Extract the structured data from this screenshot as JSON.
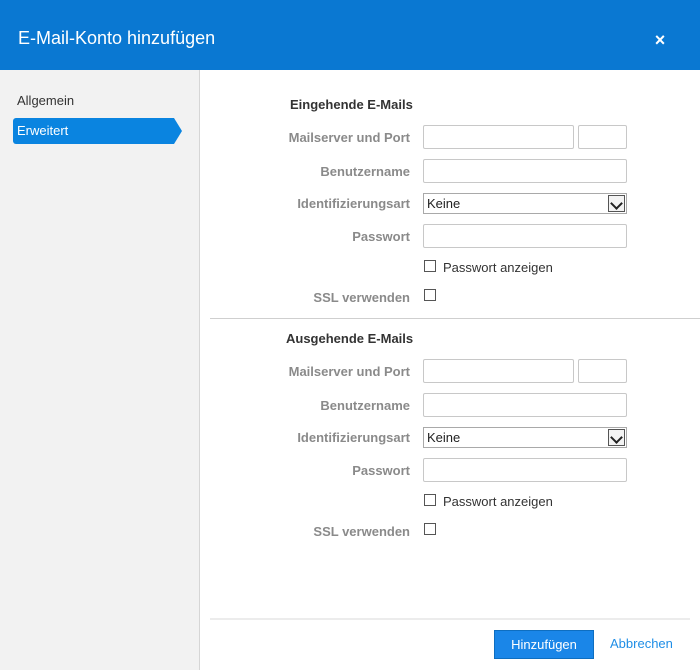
{
  "dialog": {
    "title": "E-Mail-Konto hinzufügen",
    "close_label": "×"
  },
  "sidebar": {
    "items": [
      {
        "label": "Allgemein",
        "selected": false
      },
      {
        "label": "Erweitert",
        "selected": true
      }
    ]
  },
  "incoming": {
    "title": "Eingehende E-Mails",
    "server_label": "Mailserver und Port",
    "server_value": "",
    "port_value": "",
    "username_label": "Benutzername",
    "username_value": "",
    "auth_label": "Identifizierungsart",
    "auth_value": "Keine",
    "password_label": "Passwort",
    "password_value": "",
    "show_password_label": "Passwort anzeigen",
    "show_password_checked": false,
    "ssl_label": "SSL verwenden",
    "ssl_checked": false
  },
  "outgoing": {
    "title": "Ausgehende E-Mails",
    "server_label": "Mailserver und Port",
    "server_value": "",
    "port_value": "",
    "username_label": "Benutzername",
    "username_value": "",
    "auth_label": "Identifizierungsart",
    "auth_value": "Keine",
    "password_label": "Passwort",
    "password_value": "",
    "show_password_label": "Passwort anzeigen",
    "show_password_checked": false,
    "ssl_label": "SSL verwenden",
    "ssl_checked": false
  },
  "footer": {
    "add_label": "Hinzufügen",
    "cancel_label": "Abbrechen"
  },
  "colors": {
    "header": "#0a78d2",
    "accent": "#1a86e8",
    "sidebar_bg": "#f2f2f2"
  }
}
